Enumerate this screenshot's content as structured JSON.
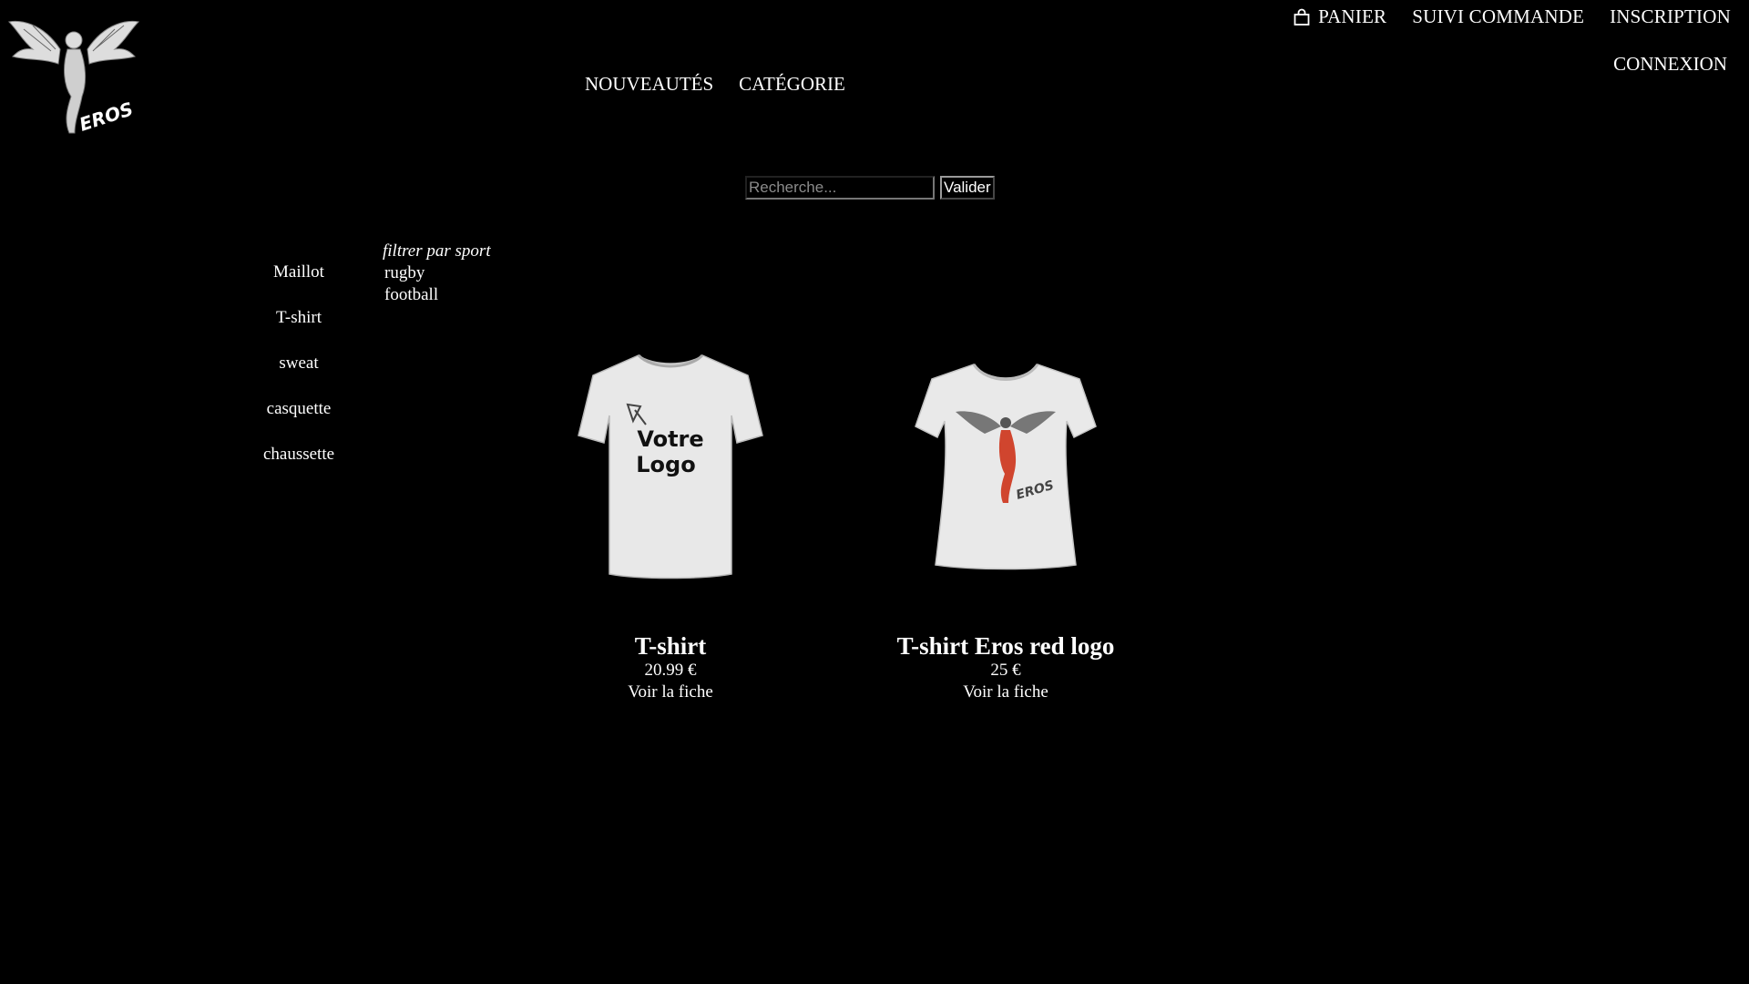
{
  "header": {
    "brand": "EROS",
    "user_nav": [
      {
        "label": "PANIER",
        "icon": "shopping-bag-icon"
      },
      {
        "label": "SUIVI COMMANDE"
      },
      {
        "label": "INSCRIPTION"
      }
    ],
    "login_label": "CONNEXION",
    "main_nav": [
      {
        "label": "NOUVEAUTÉS"
      },
      {
        "label": "CATÉGORIE"
      }
    ]
  },
  "search": {
    "placeholder": "Recherche...",
    "value": "",
    "button_label": "Valider"
  },
  "categories": [
    {
      "label": "Maillot"
    },
    {
      "label": "T-shirt"
    },
    {
      "label": "sweat"
    },
    {
      "label": "casquette"
    },
    {
      "label": "chaussette"
    }
  ],
  "filter": {
    "title": "filtrer par sport",
    "options": [
      {
        "label": "rugby"
      },
      {
        "label": "football"
      }
    ]
  },
  "products": [
    {
      "name": "T-shirt",
      "price": "20.99 €",
      "link_label": "Voir la fiche",
      "image_text_line1": "Votre",
      "image_text_line2": "Logo"
    },
    {
      "name": "T-shirt Eros red logo",
      "price": "25 €",
      "link_label": "Voir la fiche",
      "image_text": "EROS"
    }
  ],
  "colors": {
    "background": "#000000",
    "text": "#ffffff",
    "shirt": "#e8e8e8",
    "accent_red": "#d0452e"
  }
}
